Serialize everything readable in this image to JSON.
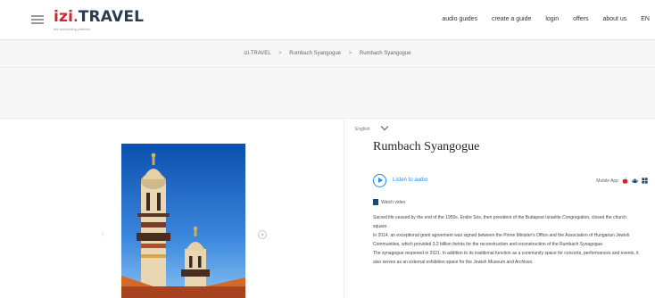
{
  "header": {
    "logo_izi": "izi",
    "logo_dot": ".",
    "logo_travel": "TRAVEL",
    "logo_tagline": "the storytelling platform",
    "nav": [
      "audio guides",
      "create a guide",
      "login",
      "offers",
      "about us",
      "EN"
    ]
  },
  "breadcrumb": {
    "items": [
      "izi.TRAVEL",
      "Rumbach Syangogue",
      "Rumbach Syangogue"
    ],
    "separator": ">"
  },
  "language": "English",
  "title": "Rumbach Syangogue",
  "listen_label": "Listen to audio",
  "mobile_app_label": "Mobile App",
  "watch_label": "Watch video",
  "description": [
    "Sacred life ceased by the end of the 1950s. Endre Sós, then president of the Budapest Israelite Congregation, closed the church square.",
    "In 2014, an exceptional grant agreement was signed between the Prime Minister's Office and the Association of Hungarian Jewish Communities, which provided 3.2 billion forints for the reconstruction and reconstruction of the Rumbach Synagogue.",
    "The synagogue reopened in 2021. In addition to its traditional function as a community space for concerts, performances and events, it also serves as an external exhibition space for the Jewish Museum and Archives."
  ],
  "colors": {
    "brand_red": "#c62931",
    "brand_navy": "#2a3d4f",
    "accent_blue": "#1d8cf8"
  },
  "icons": {
    "menu": "hamburger-menu-icon",
    "play": "play-circle-icon",
    "video": "video-icon",
    "apple": "apple-icon",
    "android": "android-icon",
    "windows": "windows-icon"
  }
}
